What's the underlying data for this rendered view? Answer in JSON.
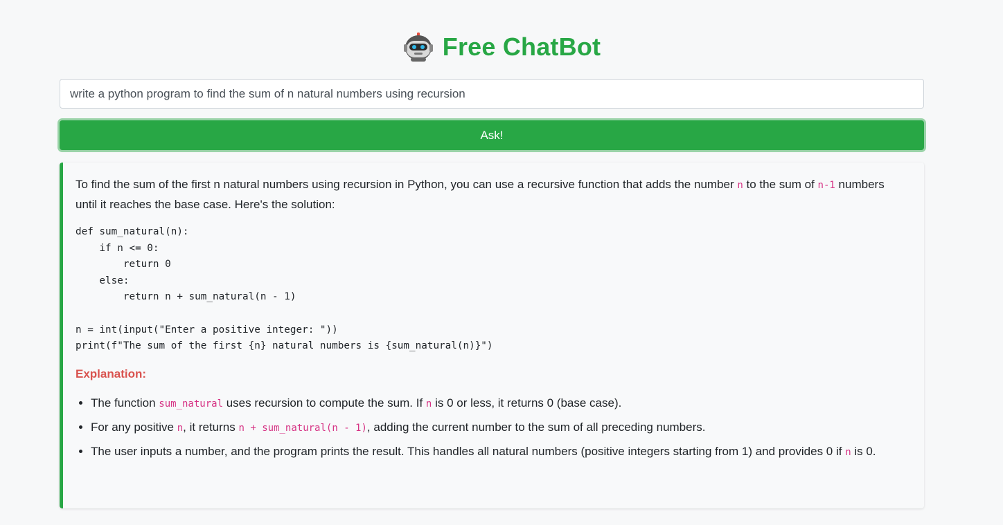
{
  "header": {
    "title": "Free ChatBot",
    "logo_icon": "robot-icon"
  },
  "question": {
    "value": "write a python program to find the sum of n natural numbers using recursion"
  },
  "ask_button": {
    "label": "Ask!"
  },
  "answer": {
    "intro": {
      "part1": "To find the sum of the first n natural numbers using recursion in Python, you can use a recursive function that adds the number ",
      "code1": "n",
      "part2": " to the sum of ",
      "code2": "n-1",
      "part3": " numbers until it reaches the base case. Here's the solution:"
    },
    "code": "def sum_natural(n):\n    if n <= 0:\n        return 0\n    else:\n        return n + sum_natural(n - 1)\n\nn = int(input(\"Enter a positive integer: \"))\nprint(f\"The sum of the first {n} natural numbers is {sum_natural(n)}\")",
    "explanation_heading": "Explanation:",
    "bullets": [
      {
        "t1": "The function ",
        "c1": "sum_natural",
        "t2": " uses recursion to compute the sum. If ",
        "c2": "n",
        "t3": " is 0 or less, it returns 0 (base case)."
      },
      {
        "t1": "For any positive ",
        "c1": "n",
        "t2": ", it returns ",
        "c2": "n + sum_natural(n - 1)",
        "t3": ", adding the current number to the sum of all preceding numbers."
      },
      {
        "t1": "The user inputs a number, and the program prints the result. This handles all natural numbers (positive integers starting from 1) and provides 0 if ",
        "c1": "n",
        "t2": " is 0."
      }
    ]
  },
  "colors": {
    "brand_green": "#28a745",
    "inline_code": "#d63384",
    "explanation_red": "#d9534f"
  }
}
